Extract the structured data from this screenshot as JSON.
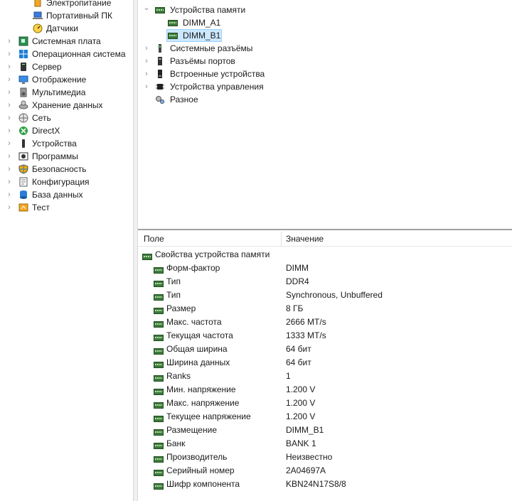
{
  "left_tree": [
    {
      "label": "Электропитание",
      "icon": "power-icon",
      "indent": 1,
      "expander": false
    },
    {
      "label": "Портативный ПК",
      "icon": "laptop-icon",
      "indent": 1,
      "expander": false
    },
    {
      "label": "Датчики",
      "icon": "sensor-gauge-icon",
      "indent": 1,
      "expander": false
    },
    {
      "label": "Системная плата",
      "icon": "motherboard-icon",
      "indent": 0,
      "expander": true
    },
    {
      "label": "Операционная система",
      "icon": "windows-icon",
      "indent": 0,
      "expander": true
    },
    {
      "label": "Сервер",
      "icon": "server-icon",
      "indent": 0,
      "expander": true
    },
    {
      "label": "Отображение",
      "icon": "monitor-icon",
      "indent": 0,
      "expander": true
    },
    {
      "label": "Мультимедиа",
      "icon": "speaker-icon",
      "indent": 0,
      "expander": true
    },
    {
      "label": "Хранение данных",
      "icon": "storage-icon",
      "indent": 0,
      "expander": true
    },
    {
      "label": "Сеть",
      "icon": "network-icon",
      "indent": 0,
      "expander": true
    },
    {
      "label": "DirectX",
      "icon": "xbox-icon",
      "indent": 0,
      "expander": true
    },
    {
      "label": "Устройства",
      "icon": "device-icon",
      "indent": 0,
      "expander": true
    },
    {
      "label": "Программы",
      "icon": "programs-icon",
      "indent": 0,
      "expander": true
    },
    {
      "label": "Безопасность",
      "icon": "shield-icon",
      "indent": 0,
      "expander": true
    },
    {
      "label": "Конфигурация",
      "icon": "config-icon",
      "indent": 0,
      "expander": true
    },
    {
      "label": "База данных",
      "icon": "database-icon",
      "indent": 0,
      "expander": true
    },
    {
      "label": "Тест",
      "icon": "test-icon",
      "indent": 0,
      "expander": true
    }
  ],
  "right_tree": [
    {
      "label": "Устройства памяти",
      "icon": "ram-icon",
      "indent": 0,
      "expander": "expanded"
    },
    {
      "label": "DIMM_A1",
      "icon": "ram-icon",
      "indent": 1,
      "expander": "none"
    },
    {
      "label": "DIMM_B1",
      "icon": "ram-icon",
      "indent": 1,
      "expander": "none",
      "selected": true
    },
    {
      "label": "Системные разъёмы",
      "icon": "slot-icon",
      "indent": 0,
      "expander": "collapsed"
    },
    {
      "label": "Разъёмы портов",
      "icon": "port-icon",
      "indent": 0,
      "expander": "collapsed"
    },
    {
      "label": "Встроенные устройства",
      "icon": "builtin-device-icon",
      "indent": 0,
      "expander": "collapsed"
    },
    {
      "label": "Устройства управления",
      "icon": "chip-icon",
      "indent": 0,
      "expander": "collapsed"
    },
    {
      "label": "Разное",
      "icon": "gears-icon",
      "indent": 0,
      "expander": "none"
    }
  ],
  "table": {
    "col_field": "Поле",
    "col_value": "Значение",
    "group": "Свойства устройства памяти",
    "rows": [
      {
        "field": "Форм-фактор",
        "value": "DIMM"
      },
      {
        "field": "Тип",
        "value": "DDR4"
      },
      {
        "field": "Тип",
        "value": "Synchronous, Unbuffered"
      },
      {
        "field": "Размер",
        "value": "8 ГБ"
      },
      {
        "field": "Макс. частота",
        "value": "2666 MT/s"
      },
      {
        "field": "Текущая частота",
        "value": "1333 MT/s"
      },
      {
        "field": "Общая ширина",
        "value": "64 бит"
      },
      {
        "field": "Ширина данных",
        "value": "64 бит"
      },
      {
        "field": "Ranks",
        "value": "1"
      },
      {
        "field": "Мин. напряжение",
        "value": "1.200 V"
      },
      {
        "field": "Макс. напряжение",
        "value": "1.200 V"
      },
      {
        "field": "Текущее напряжение",
        "value": "1.200 V"
      },
      {
        "field": "Размещение",
        "value": "DIMM_B1"
      },
      {
        "field": "Банк",
        "value": "BANK 1"
      },
      {
        "field": "Производитель",
        "value": "Неизвестно"
      },
      {
        "field": "Серийный номер",
        "value": "2A04697A"
      },
      {
        "field": "Шифр компонента",
        "value": "KBN24N17S8/8"
      }
    ]
  },
  "colors": {
    "selection": "#cce8ff",
    "ram_green": "#3d7a3d"
  }
}
